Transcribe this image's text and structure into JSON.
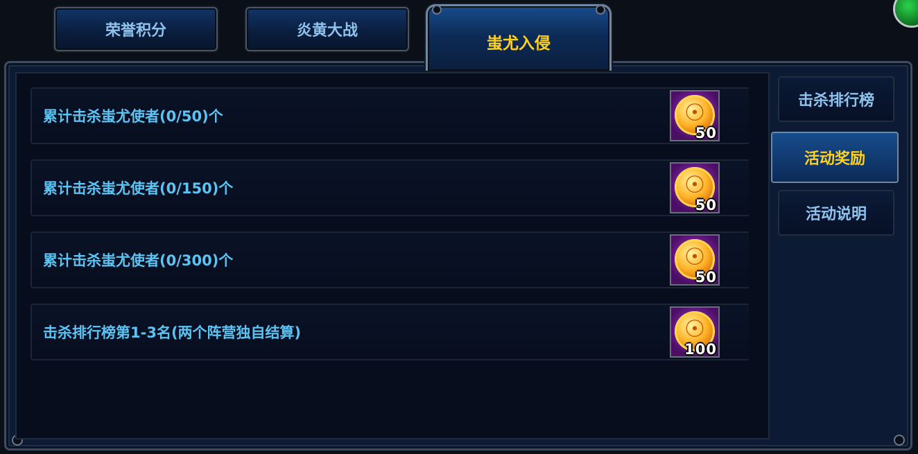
{
  "tabs": [
    {
      "label": "荣誉积分",
      "active": false
    },
    {
      "label": "炎黄大战",
      "active": false
    },
    {
      "label": "蚩尤入侵",
      "active": true
    }
  ],
  "rewards": [
    {
      "description": "累计击杀蚩尤使者(0/50)个",
      "icon": "gold-coin-icon",
      "amount": "50"
    },
    {
      "description": "累计击杀蚩尤使者(0/150)个",
      "icon": "gold-coin-icon",
      "amount": "50"
    },
    {
      "description": "累计击杀蚩尤使者(0/300)个",
      "icon": "gold-coin-icon",
      "amount": "50"
    },
    {
      "description": "击杀排行榜第1-3名(两个阵营独自结算)",
      "icon": "gold-coin-icon",
      "amount": "100"
    }
  ],
  "side_menu": [
    {
      "label": "击杀排行榜",
      "active": false
    },
    {
      "label": "活动奖励",
      "active": true
    },
    {
      "label": "活动说明",
      "active": false
    }
  ],
  "colors": {
    "active_text": "#ffd21f",
    "inactive_text": "#8fc3ee",
    "description_text": "#5cc4f4"
  }
}
